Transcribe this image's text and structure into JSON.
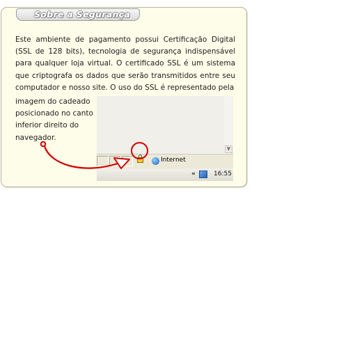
{
  "section": {
    "title": "Sobre a Segurança",
    "paragraph": "Este ambiente de pagamento possui Certificação Digital (SSL de 128 bits), tecnologia de segurança indispensável para qualquer loja virtual. O certificado SSL é um sistema que criptografa os dados que serão transmitidos entre seu computador e nosso site. O uso do SSL é representado pela",
    "paragraph_continued": "imagem do cadeado posicionado no canto inferior direito do navegador."
  },
  "browser_mock": {
    "zone_label": "Internet",
    "tray_chevron": "«",
    "clock": "16:55"
  },
  "icons": {
    "lock": "padlock-icon",
    "zone": "globe-icon",
    "tray_network": "network-icon"
  },
  "colors": {
    "card_background": "#fefde9",
    "highlight_red": "#d40000"
  }
}
